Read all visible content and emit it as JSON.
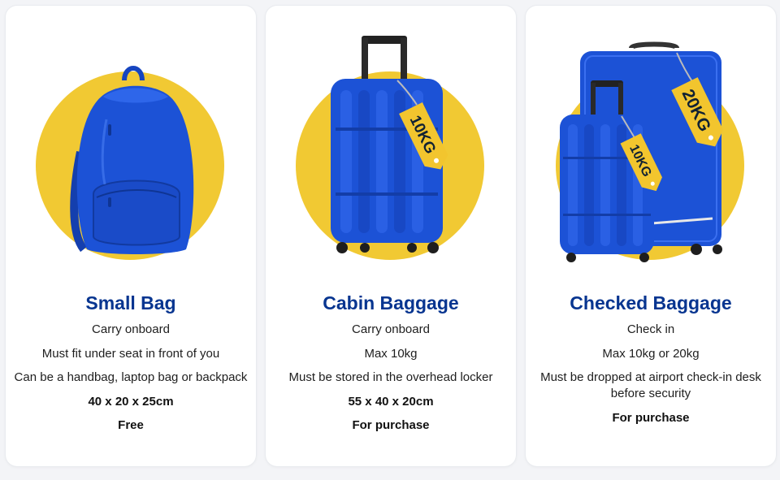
{
  "colors": {
    "title": "#073590",
    "circle": "#F1C933",
    "bag_blue": "#1c52d6",
    "tag": "#F2C52E"
  },
  "cards": [
    {
      "title": "Small Bag",
      "icon": "backpack-icon",
      "lines": [
        "Carry onboard",
        "Must fit under seat in front of you",
        "Can be a handbag, laptop bag or backpack"
      ],
      "dimensions": "40 x 20 x 25cm",
      "price": "Free"
    },
    {
      "title": "Cabin Baggage",
      "icon": "suitcase-icon",
      "tag": "10KG",
      "lines": [
        "Carry onboard",
        "Max 10kg",
        "Must be stored in the overhead locker"
      ],
      "dimensions": "55 x 40 x 20cm",
      "price": "For purchase"
    },
    {
      "title": "Checked Baggage",
      "icon": "luggage-set-icon",
      "tags": [
        "20KG",
        "10KG"
      ],
      "lines": [
        "Check in",
        "Max 10kg or 20kg",
        "Must be dropped at airport check-in desk before security"
      ],
      "price": "For purchase"
    }
  ]
}
